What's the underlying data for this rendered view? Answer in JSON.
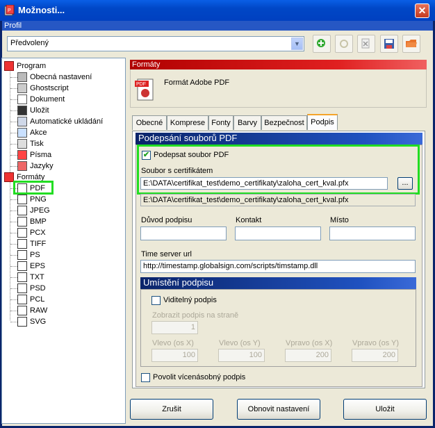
{
  "window": {
    "title": "Možnosti...",
    "close": "✕"
  },
  "profile": {
    "label": "Profil",
    "selected": "Předvolený",
    "buttons": [
      "add-icon",
      "settings-icon",
      "delete-icon",
      "save-icon",
      "open-folder-icon"
    ]
  },
  "tree": {
    "program": "Program",
    "program_items": [
      "Obecná nastavení",
      "Ghostscript",
      "Dokument",
      "Uložit",
      "Automatické ukládání",
      "Akce",
      "Tisk",
      "Písma",
      "Jazyky"
    ],
    "formats": "Formáty",
    "format_items": [
      "PDF",
      "PNG",
      "JPEG",
      "BMP",
      "PCX",
      "TIFF",
      "PS",
      "EPS",
      "TXT",
      "PSD",
      "PCL",
      "RAW",
      "SVG"
    ]
  },
  "panel": {
    "header": "Formáty",
    "format_name": "Formát Adobe PDF"
  },
  "tabs": [
    "Obecné",
    "Komprese",
    "Fonty",
    "Barvy",
    "Bezpečnost",
    "Podpis"
  ],
  "sign": {
    "group_title": "Podepsání souborů PDF",
    "sign_checkbox": "Podepsat soubor PDF",
    "cert_label": "Soubor s certifikátem",
    "cert_path": "E:\\DATA\\certifikat_test\\demo_certifikaty\\zaloha_cert_kval.pfx",
    "browse": "...",
    "cert_path_readonly": "E:\\DATA\\certifikat_test\\demo_certifikaty\\zaloha_cert_kval.pfx",
    "reason_label": "Důvod podpisu",
    "contact_label": "Kontakt",
    "location_label": "Místo",
    "reason": "",
    "contact": "",
    "location": "",
    "timeserver_label": "Time server url",
    "timeserver": "http://timestamp.globalsign.com/scripts/timstamp.dll"
  },
  "placement": {
    "group_title": "Umístění podpisu",
    "visible_label": "Viditelný podpis",
    "page_label": "Zobrazit podpis na straně",
    "page_value": "1",
    "left_x_label": "Vlevo (os X)",
    "left_y_label": "Vlevo (os Y)",
    "right_x_label": "Vpravo (os X)",
    "right_y_label": "Vpravo (os Y)",
    "left_x": "100",
    "left_y": "100",
    "right_x": "200",
    "right_y": "200"
  },
  "multi_sign_label": "Povolit vícenásobný podpis",
  "buttons": {
    "cancel": "Zrušit",
    "reset": "Obnovit nastavení",
    "save": "Uložit"
  }
}
